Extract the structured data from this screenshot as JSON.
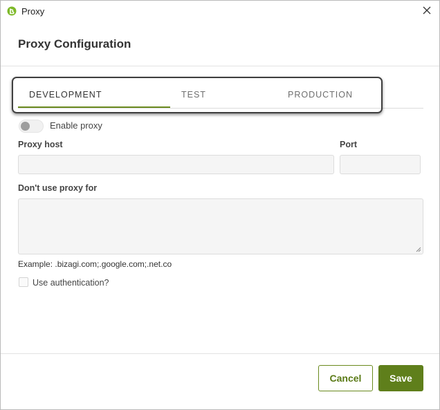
{
  "window": {
    "title": "Proxy",
    "close_icon": "close-icon",
    "app_icon": "bizagi-app-icon"
  },
  "dialog": {
    "title": "Proxy Configuration"
  },
  "tabs": [
    {
      "label": "DEVELOPMENT",
      "active": true
    },
    {
      "label": "TEST",
      "active": false
    },
    {
      "label": "PRODUCTION",
      "active": false
    }
  ],
  "form": {
    "enable_proxy": {
      "label": "Enable proxy",
      "checked": false
    },
    "proxy_host": {
      "label": "Proxy host",
      "value": ""
    },
    "port": {
      "label": "Port",
      "value": ""
    },
    "no_proxy": {
      "label": "Don't use proxy for",
      "value": ""
    },
    "example": "Example: .bizagi.com;.google.com;.net.co",
    "use_auth": {
      "label": "Use authentication?",
      "checked": false
    }
  },
  "footer": {
    "cancel_label": "Cancel",
    "save_label": "Save"
  },
  "colors": {
    "accent": "#5f7f1b",
    "tab_underline": "#6a8a1e",
    "input_bg": "#f5f5f5"
  }
}
